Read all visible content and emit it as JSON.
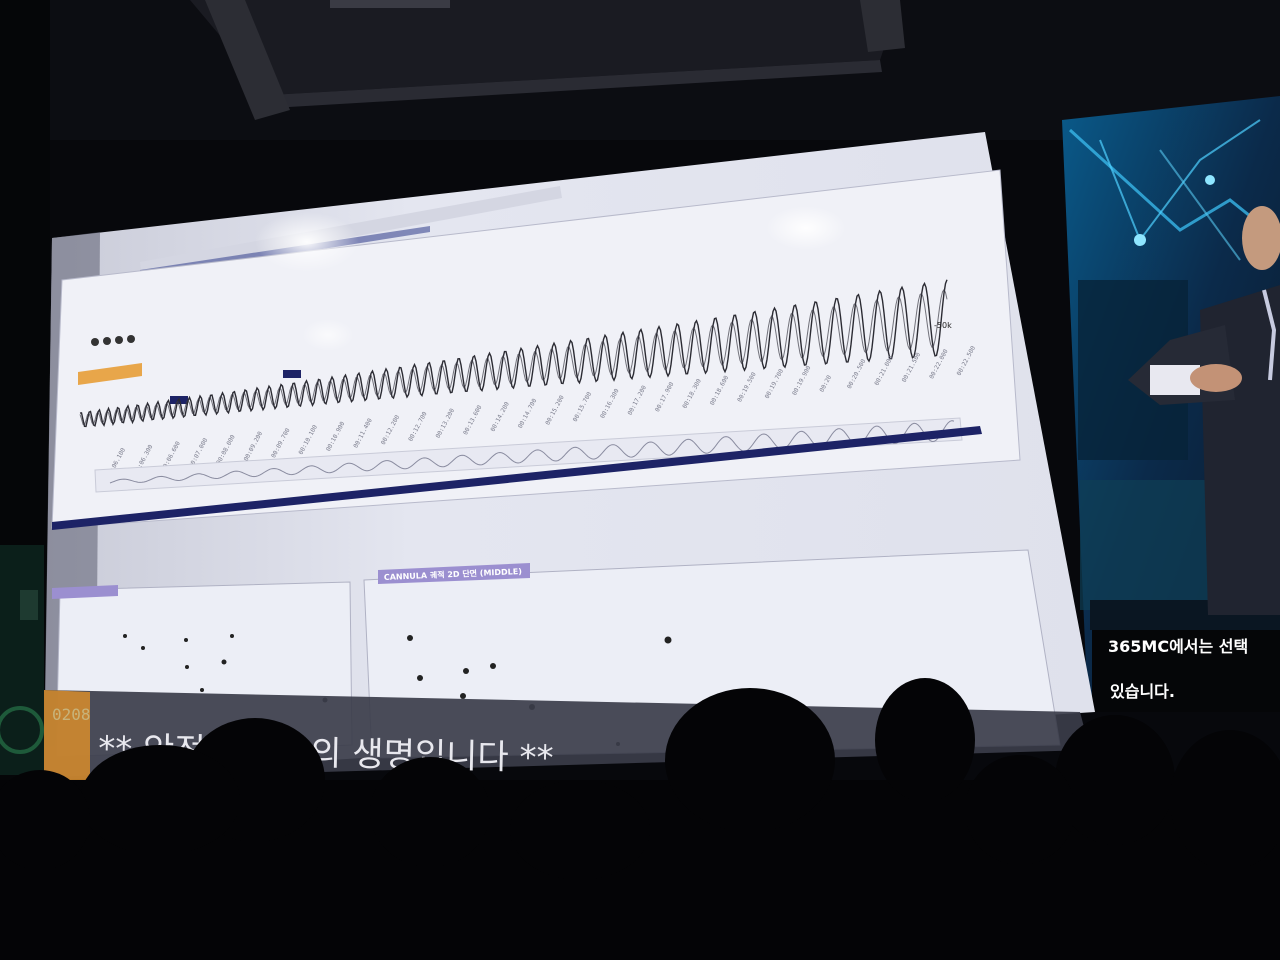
{
  "side_screen": {
    "caption_line1": "365MC에서는 선택",
    "caption_line2": "있습니다."
  },
  "dashboard": {
    "panel_label": "CANNULA 궤적 2D 단면 (MIDDLE)",
    "chart_end_label": "-50k",
    "time_ticks": [
      "00:06.100",
      "00:06.300",
      "00:06.600",
      "00:07.000",
      "00:08.000",
      "00:09.200",
      "00:09.700",
      "00:10.100",
      "00:10.900",
      "00:11.400",
      "00:12.200",
      "00:12.700",
      "00:13.200",
      "00:13.600",
      "00:14.200",
      "00:14.700",
      "00:15.200",
      "00:15.700",
      "00:16.300",
      "00:17.200",
      "00:17.900",
      "00:18.300",
      "00:18.600",
      "00:19.500",
      "00:19.700",
      "00:19.900",
      "00:20",
      "00:20.500",
      "00:21.000",
      "00:21.500",
      "00:22.000",
      "00:22.500"
    ],
    "ticker_code": "0208",
    "ticker_text": "** 안전은 의사의 생명입니다 **"
  },
  "colors": {
    "screen_bg": "#e6e8f2",
    "panel_label_bg": "#9b8fd0",
    "timeline_bar": "#1d2366",
    "waveform": "#2b2b33",
    "caption_text": "#ffffff"
  }
}
